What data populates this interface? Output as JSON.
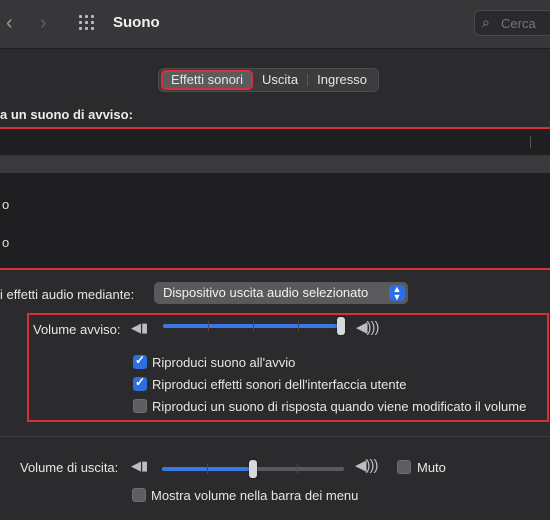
{
  "window": {
    "title": "Suono"
  },
  "toolbar": {
    "back_icon": "‹",
    "forward_icon": "›"
  },
  "search": {
    "placeholder": "Cerca"
  },
  "tabs": [
    {
      "label": "Effetti sonori",
      "active": true
    },
    {
      "label": "Uscita",
      "active": false
    },
    {
      "label": "Ingresso",
      "active": false
    }
  ],
  "alert_section": {
    "label": "a un suono di avviso:"
  },
  "sound_list": {
    "rows": [
      "o",
      "o"
    ]
  },
  "play_through": {
    "label": "i effetti audio mediante:",
    "selected": "Dispositivo uscita audio selezionato"
  },
  "alert_volume": {
    "label": "Volume avviso:",
    "level": 1.0
  },
  "checkboxes": [
    {
      "label": "Riproduci suono all'avvio",
      "checked": true
    },
    {
      "label": "Riproduci effetti sonori dell'interfaccia utente",
      "checked": true
    },
    {
      "label": "Riproduci un suono di risposta quando viene modificato il volume",
      "checked": false
    }
  ],
  "output_volume": {
    "label": "Volume di uscita:",
    "level": 0.5,
    "mute_label": "Muto",
    "mute_checked": false
  },
  "menu_bar_option": {
    "label": "Mostra volume nella barra dei menu",
    "checked": false
  },
  "colors": {
    "accent": "#2d6fe0",
    "highlight": "#d63038",
    "background": "#2b2b2d"
  }
}
